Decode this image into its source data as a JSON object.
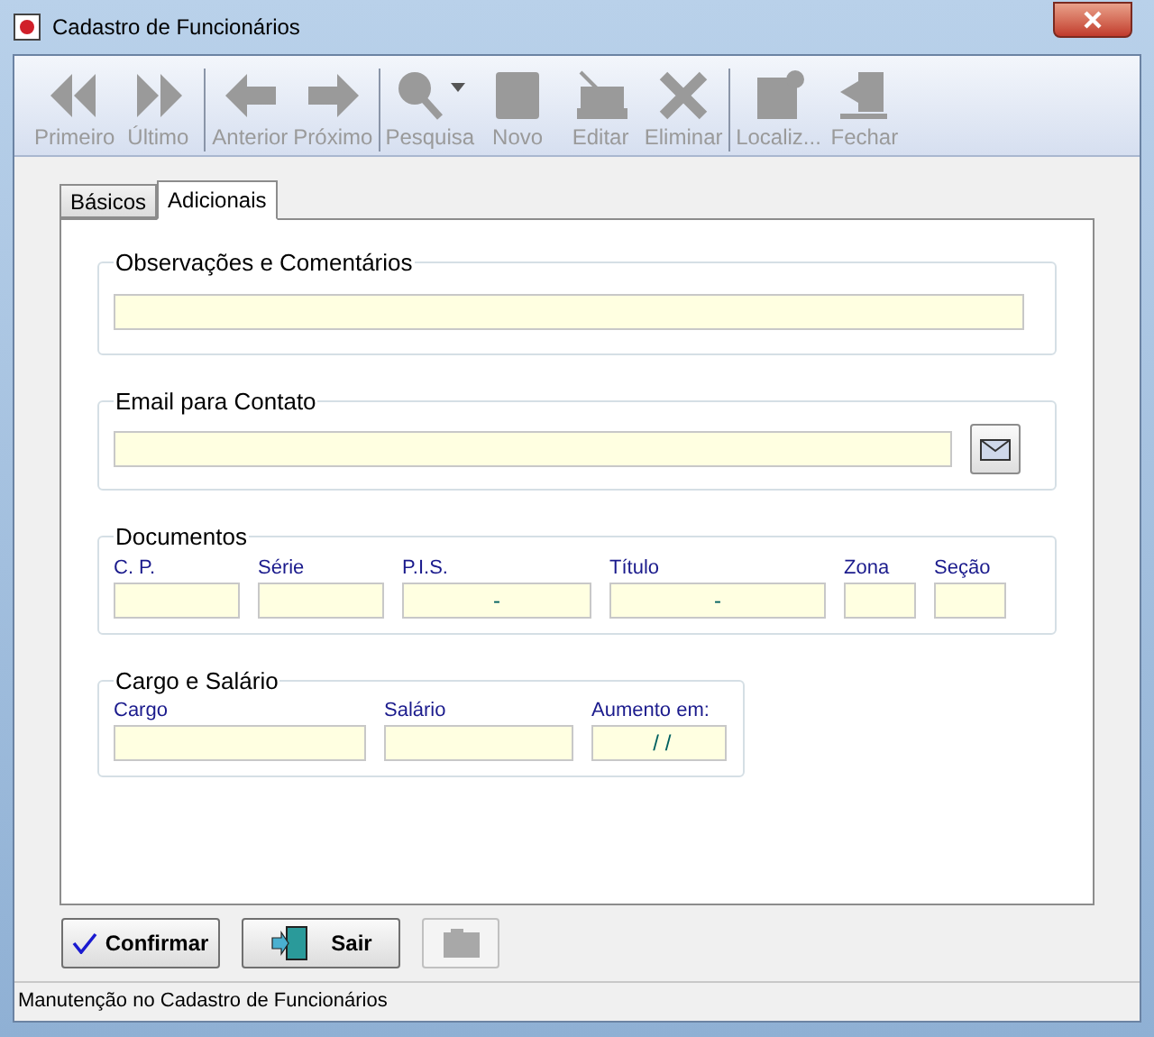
{
  "window": {
    "title": "Cadastro de Funcionários"
  },
  "toolbar": {
    "groups": [
      [
        {
          "label": "Primeiro",
          "disabled": true
        },
        {
          "label": "Último",
          "disabled": true
        }
      ],
      [
        {
          "label": "Anterior",
          "disabled": true
        },
        {
          "label": "Próximo",
          "disabled": true
        }
      ],
      [
        {
          "label": "Pesquisa",
          "disabled": true
        },
        {
          "label": "Novo",
          "disabled": true
        },
        {
          "label": "Editar",
          "disabled": true
        },
        {
          "label": "Eliminar",
          "disabled": true
        }
      ],
      [
        {
          "label": "Localiz...",
          "disabled": true
        },
        {
          "label": "Fechar",
          "disabled": true
        }
      ]
    ]
  },
  "tabs": [
    {
      "label": "Básicos",
      "selected": false
    },
    {
      "label": "Adicionais",
      "selected": true
    }
  ],
  "observacoes": {
    "title": "Observações e Comentários"
  },
  "email": {
    "title": "Email para Contato"
  },
  "documentos": {
    "title": "Documentos",
    "fields": [
      {
        "label": "C. P."
      },
      {
        "label": "Série"
      },
      {
        "label": "P.I.S.",
        "value": "-"
      },
      {
        "label": "Título",
        "value": "-"
      },
      {
        "label": "Zona"
      },
      {
        "label": "Seção"
      }
    ]
  },
  "cargo": {
    "title": "Cargo e Salário",
    "fields": [
      {
        "label": "Cargo"
      },
      {
        "label": "Salário"
      },
      {
        "label": "Aumento em:",
        "value": " / /"
      }
    ]
  },
  "buttons": [
    {
      "label": "Confirmar",
      "disabled": false
    },
    {
      "label": "Sair",
      "disabled": false
    },
    {
      "disabled": true
    }
  ],
  "status_bar": "Manutenção no Cadastro de Funcionários"
}
